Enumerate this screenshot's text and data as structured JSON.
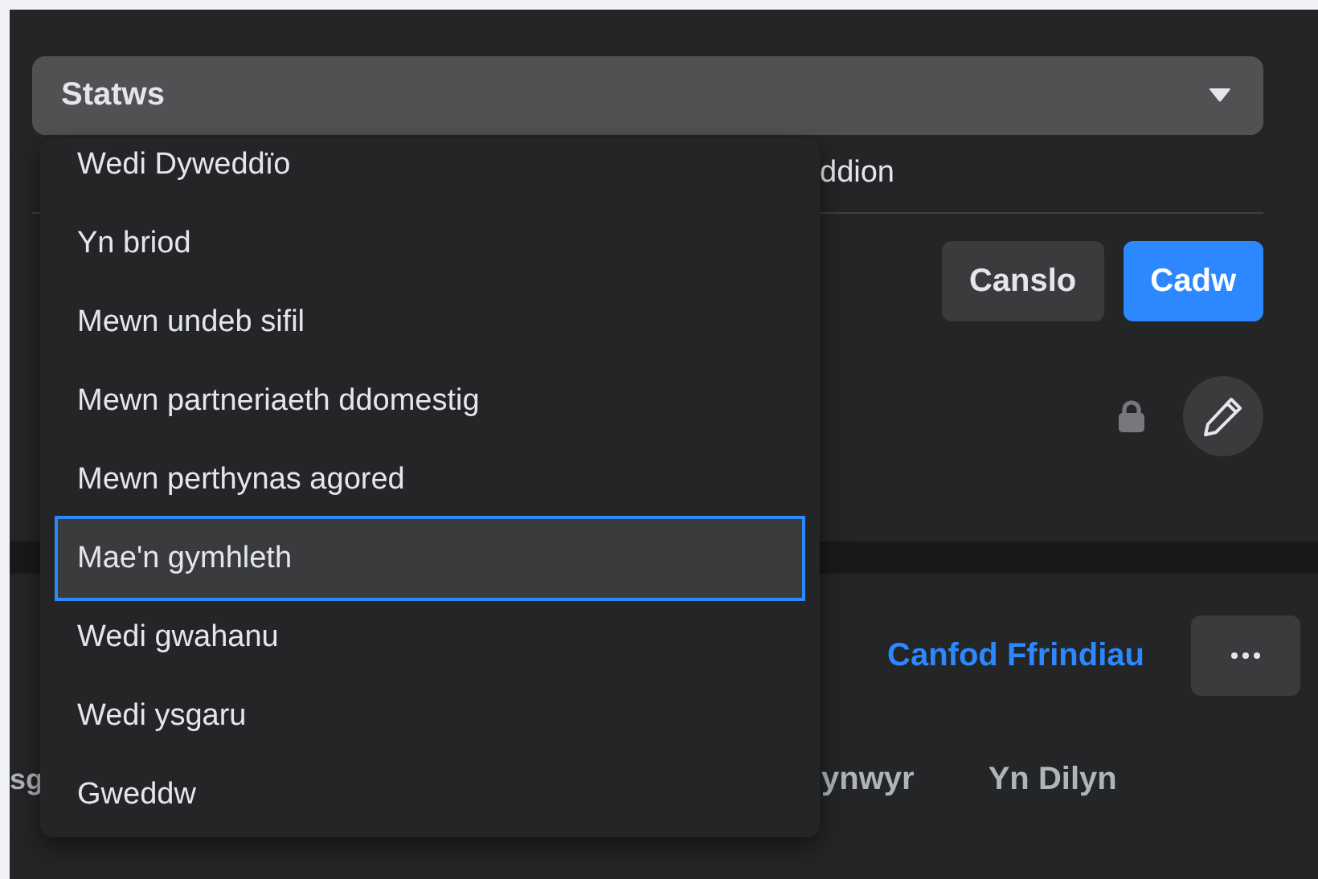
{
  "status_select": {
    "label": "Statws",
    "options": [
      {
        "label": "Wedi Dyweddïo",
        "selected": false
      },
      {
        "label": "Yn briod",
        "selected": false
      },
      {
        "label": "Mewn undeb sifil",
        "selected": false
      },
      {
        "label": "Mewn partneriaeth ddomestig",
        "selected": false
      },
      {
        "label": "Mewn perthynas agored",
        "selected": false
      },
      {
        "label": "Mae'n gymhleth",
        "selected": true
      },
      {
        "label": "Wedi gwahanu",
        "selected": false
      },
      {
        "label": "Wedi ysgaru",
        "selected": false
      },
      {
        "label": "Gweddw",
        "selected": false
      }
    ]
  },
  "field_behind_menu": {
    "text": "ddion"
  },
  "edit_buttons": [
    {
      "label": "Canslo",
      "kind": "secondary"
    },
    {
      "label": "Cadw",
      "kind": "primary"
    }
  ],
  "friends_section": {
    "link": "Canfod Ffrindiau",
    "tabs": [
      {
        "label": "sg",
        "selected": false
      },
      {
        "label": "ynwyr",
        "selected": false
      },
      {
        "label": "Yn Dilyn",
        "selected": false
      }
    ]
  }
}
